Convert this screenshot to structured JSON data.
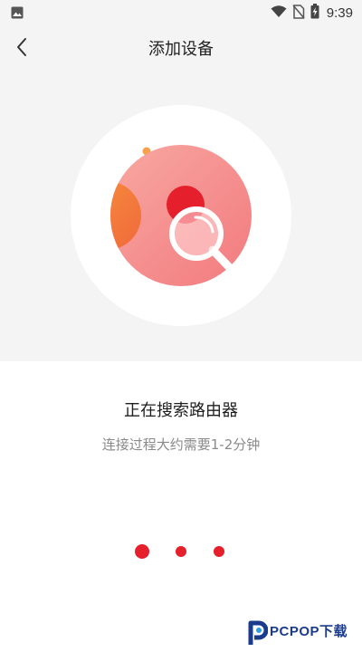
{
  "status_bar": {
    "time": "9:39",
    "icons": [
      "photo-icon",
      "wifi-icon",
      "no-sim-icon",
      "battery-charging-icon"
    ]
  },
  "header": {
    "title": "添加设备",
    "back_icon": "chevron-left-icon"
  },
  "illustration": {
    "icon": "search-magnifier-icon",
    "accent_color": "#f58a8a",
    "highlight_color": "#e5202c"
  },
  "status": {
    "title": "正在搜索路由器",
    "subtitle": "连接过程大约需要1-2分钟"
  },
  "loading": {
    "dot_color": "#e5202c"
  },
  "watermark": {
    "text": "PCPOP下载"
  }
}
